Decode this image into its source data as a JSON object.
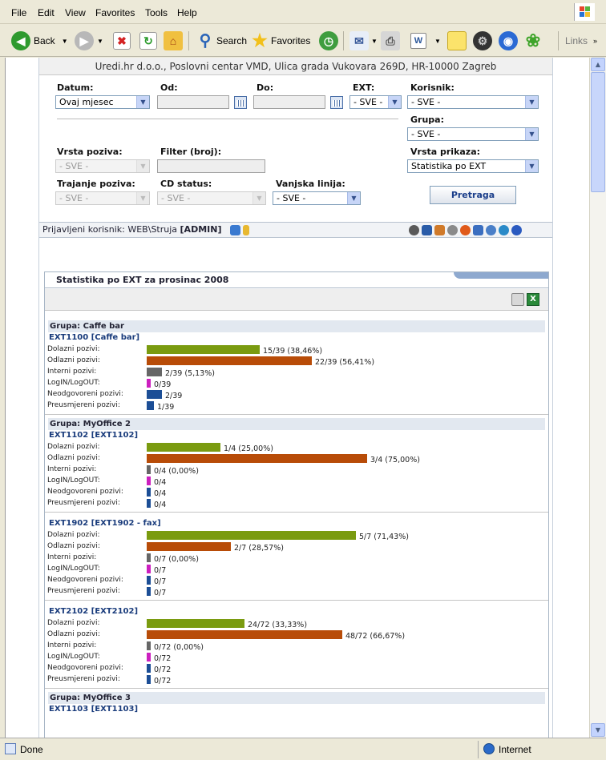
{
  "menu": [
    "File",
    "Edit",
    "View",
    "Favorites",
    "Tools",
    "Help"
  ],
  "toolbar": {
    "back": "Back",
    "search": "Search",
    "favorites": "Favorites",
    "links": "Links"
  },
  "company": "Uredi.hr d.o.o., Poslovni centar VMD, Ulica grada Vukovara 269D, HR-10000 Zagreb",
  "form": {
    "datum_label": "Datum:",
    "datum_value": "Ovaj mjesec",
    "od_label": "Od:",
    "do_label": "Do:",
    "ext_label": "EXT:",
    "ext_value": "- SVE -",
    "korisnik_label": "Korisnik:",
    "korisnik_value": "- SVE -",
    "grupa_label": "Grupa:",
    "grupa_value": "- SVE -",
    "vrsta_poziva_label": "Vrsta poziva:",
    "vrsta_poziva_value": "- SVE -",
    "filter_label": "Filter (broj):",
    "vrsta_prikaza_label": "Vrsta prikaza:",
    "vrsta_prikaza_value": "Statistika po EXT",
    "trajanje_label": "Trajanje poziva:",
    "trajanje_value": "- SVE -",
    "cd_label": "CD status:",
    "cd_value": "- SVE -",
    "vanjska_label": "Vanjska linija:",
    "vanjska_value": "- SVE -",
    "search_button": "Pretraga"
  },
  "user": {
    "prefix": "Prijavljeni korisnik:",
    "name": "WEB\\Struja",
    "role": "[ADMIN]"
  },
  "panel_title": "Statistika po EXT za prosinac 2008",
  "row_labels": [
    "Dolazni pozivi:",
    "Odlazni pozivi:",
    "Interni pozivi:",
    "LogIN/LogOUT:",
    "Neodgovoreni pozivi:",
    "Preusmjereni pozivi:"
  ],
  "colors": {
    "dolazni": "#7a9b10",
    "odlazni": "#b84c08",
    "interni": "#666666",
    "login": "#cc1fbf",
    "neodgovoreni": "#1c4e96",
    "preusmjereni": "#1c4e96"
  },
  "groups": [
    {
      "label": "Grupa: Caffe bar",
      "exts": [
        {
          "name": "EXT1100 [Caffe bar]",
          "rows": [
            {
              "value": "15/39 (38,46%)",
              "frac": 0.3846
            },
            {
              "value": "22/39 (56,41%)",
              "frac": 0.5641
            },
            {
              "value": "2/39 (5,13%)",
              "frac": 0.0513
            },
            {
              "value": "0/39",
              "frac": 0.0
            },
            {
              "value": "2/39",
              "frac": 0.0513
            },
            {
              "value": "1/39",
              "frac": 0.0256
            }
          ]
        }
      ]
    },
    {
      "label": "Grupa: MyOffice 2",
      "exts": [
        {
          "name": "EXT1102 [EXT1102]",
          "rows": [
            {
              "value": "1/4 (25,00%)",
              "frac": 0.25
            },
            {
              "value": "3/4 (75,00%)",
              "frac": 0.75
            },
            {
              "value": "0/4 (0,00%)",
              "frac": 0.0
            },
            {
              "value": "0/4",
              "frac": 0.0
            },
            {
              "value": "0/4",
              "frac": 0.0
            },
            {
              "value": "0/4",
              "frac": 0.0
            }
          ]
        },
        {
          "name": "EXT1902 [EXT1902 - fax]",
          "rows": [
            {
              "value": "5/7 (71,43%)",
              "frac": 0.7143
            },
            {
              "value": "2/7 (28,57%)",
              "frac": 0.2857
            },
            {
              "value": "0/7 (0,00%)",
              "frac": 0.0
            },
            {
              "value": "0/7",
              "frac": 0.0
            },
            {
              "value": "0/7",
              "frac": 0.0
            },
            {
              "value": "0/7",
              "frac": 0.0
            }
          ]
        },
        {
          "name": "EXT2102 [EXT2102]",
          "rows": [
            {
              "value": "24/72 (33,33%)",
              "frac": 0.3333
            },
            {
              "value": "48/72 (66,67%)",
              "frac": 0.6667
            },
            {
              "value": "0/72 (0,00%)",
              "frac": 0.0
            },
            {
              "value": "0/72",
              "frac": 0.0
            },
            {
              "value": "0/72",
              "frac": 0.0
            },
            {
              "value": "0/72",
              "frac": 0.0
            }
          ]
        }
      ]
    },
    {
      "label": "Grupa: MyOffice 3",
      "exts": [
        {
          "name": "EXT1103 [EXT1103]",
          "rows": []
        }
      ]
    }
  ],
  "status": {
    "left": "Done",
    "zone": "Internet"
  }
}
